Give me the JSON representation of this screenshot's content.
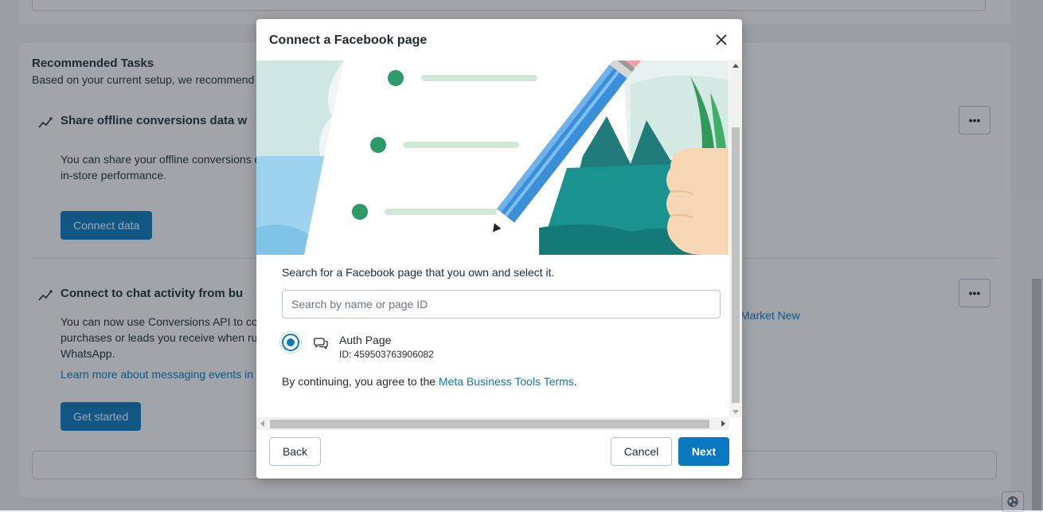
{
  "background": {
    "recommended": {
      "title": "Recommended Tasks",
      "subtitle": "Based on your current setup, we recommend t"
    },
    "tasks": [
      {
        "title": "Share offline conversions data w",
        "description": "You can share your offline conversions d in-store performance.",
        "button_label": "Connect data",
        "more_label": "•••"
      },
      {
        "title": "Connect to chat activity from bu",
        "description": "You can now use Conversions API to con purchases or leads you receive when ru WhatsApp.",
        "link_label": "Learn more about messaging events in b",
        "button_label": "Get started",
        "more_label": "•••"
      }
    ],
    "side_link": "Market New"
  },
  "dialog": {
    "title": "Connect a Facebook page",
    "close_icon": "close-icon",
    "instruction": "Search for a Facebook page that you own and select it.",
    "search_placeholder": "Search by name or page ID",
    "search_value": "",
    "page": {
      "name": "Auth Page",
      "id_text": "ID: 459503763906082",
      "selected": true,
      "icon": "chat-bubbles-icon"
    },
    "terms_prefix": "By continuing, you agree to the ",
    "terms_link": "Meta Business Tools Terms",
    "terms_suffix": ".",
    "back_label": "Back",
    "cancel_label": "Cancel",
    "next_label": "Next"
  },
  "colors": {
    "primary": "#0a78be",
    "text": "#1c2b33",
    "border": "#b8c2cc"
  }
}
